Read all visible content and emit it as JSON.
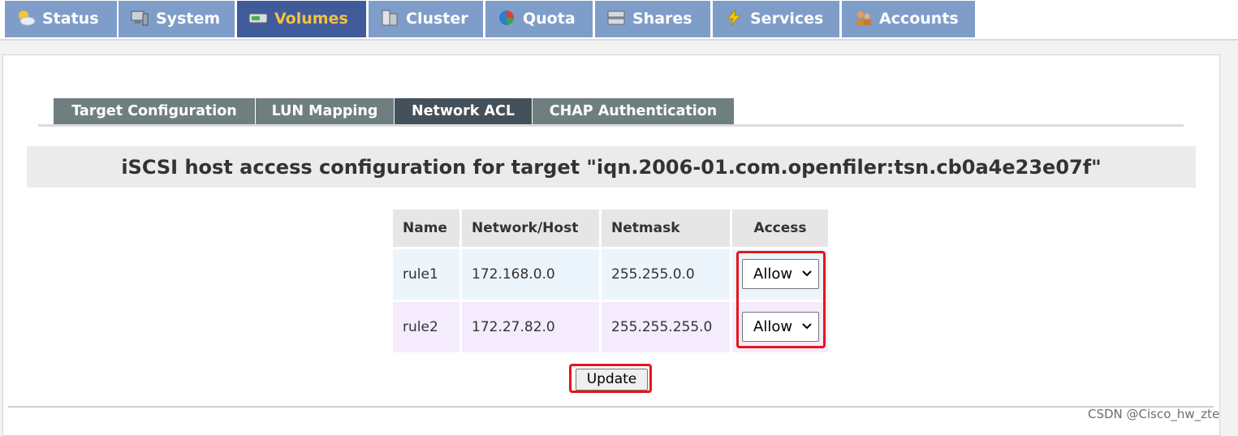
{
  "topnav": {
    "tabs": [
      {
        "label": "Status",
        "icon": "weather-icon"
      },
      {
        "label": "System",
        "icon": "monitor-icon"
      },
      {
        "label": "Volumes",
        "icon": "disk-icon"
      },
      {
        "label": "Cluster",
        "icon": "server-icon"
      },
      {
        "label": "Quota",
        "icon": "pie-icon"
      },
      {
        "label": "Shares",
        "icon": "drive-icon"
      },
      {
        "label": "Services",
        "icon": "lightning-icon"
      },
      {
        "label": "Accounts",
        "icon": "users-icon"
      }
    ],
    "active": "Volumes"
  },
  "subtabs": {
    "items": [
      "Target Configuration",
      "LUN Mapping",
      "Network ACL",
      "CHAP Authentication"
    ],
    "active": "Network ACL"
  },
  "heading": "iSCSI host access configuration for target \"iqn.2006-01.com.openfiler:tsn.cb0a4e23e07f\"",
  "acl_table": {
    "columns": [
      "Name",
      "Network/Host",
      "Netmask",
      "Access"
    ],
    "rows": [
      {
        "name": "rule1",
        "network": "172.168.0.0",
        "netmask": "255.255.0.0",
        "access": "Allow"
      },
      {
        "name": "rule2",
        "network": "172.27.82.0",
        "netmask": "255.255.255.0",
        "access": "Allow"
      }
    ]
  },
  "update_label": "Update",
  "watermark": "CSDN @Cisco_hw_zte",
  "colors": {
    "tab_bg": "#7f9dc9",
    "tab_active_bg": "#3f5b9a",
    "tab_active_text": "#f2c243",
    "subtab_bg": "#6f7f80",
    "subtab_active_bg": "#44505a",
    "highlight": "#e8141b"
  }
}
